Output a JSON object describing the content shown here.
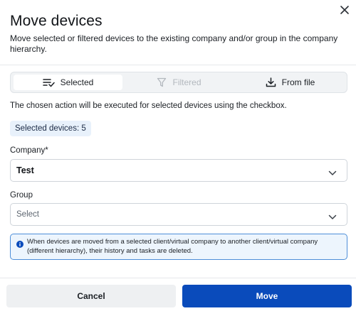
{
  "dialog": {
    "title": "Move devices",
    "description": "Move selected or filtered devices to the existing company and/or group in the company hierarchy.",
    "close_icon": "close-icon"
  },
  "tabs": [
    {
      "label": "Selected",
      "icon": "list-check-icon",
      "state": "active"
    },
    {
      "label": "Filtered",
      "icon": "filter-icon",
      "state": "disabled"
    },
    {
      "label": "From file",
      "icon": "download-icon",
      "state": "default"
    }
  ],
  "info_text": "The chosen action will be executed for selected devices using the checkbox.",
  "selected_badge": "Selected devices: 5",
  "company": {
    "label": "Company*",
    "value": "Test"
  },
  "group": {
    "label": "Group",
    "placeholder": "Select"
  },
  "alert": {
    "icon": "info-icon",
    "text": "When devices are moved from a selected client/virtual company to another client/virtual company (different hierarchy), their history and tasks are deleted."
  },
  "footer": {
    "cancel_label": "Cancel",
    "move_label": "Move"
  },
  "colors": {
    "primary": "#0a4bbb",
    "alert_border": "#4d8ed8",
    "alert_bg": "#edf5fd",
    "badge_bg": "#e8f1fb"
  }
}
